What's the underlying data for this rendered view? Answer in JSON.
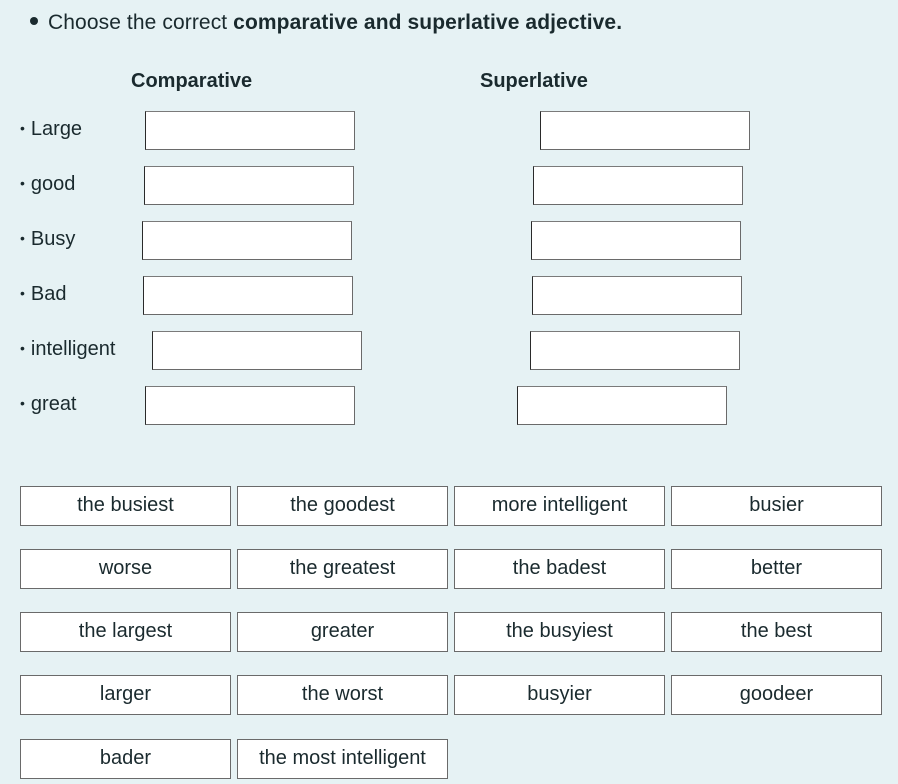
{
  "instruction": {
    "prefix": "Choose the correct ",
    "bold": "comparative and superlative adjective."
  },
  "columns": {
    "comparative": "Comparative",
    "superlative": "Superlative"
  },
  "adjectives": [
    {
      "label": "Large",
      "comparative_value": "",
      "superlative_value": ""
    },
    {
      "label": "good",
      "comparative_value": "",
      "superlative_value": ""
    },
    {
      "label": "Busy",
      "comparative_value": "",
      "superlative_value": ""
    },
    {
      "label": "Bad",
      "comparative_value": "",
      "superlative_value": ""
    },
    {
      "label": "intelligent",
      "comparative_value": "",
      "superlative_value": ""
    },
    {
      "label": "great",
      "comparative_value": "",
      "superlative_value": ""
    }
  ],
  "word_bank": [
    "the busiest",
    "the goodest",
    "more intelligent",
    "busier",
    "worse",
    "the greatest",
    "the badest",
    "better",
    "the largest",
    "greater",
    "the busyiest",
    "the best",
    "larger",
    "the worst",
    "busyier",
    "goodeer",
    "bader",
    "the most intelligent"
  ],
  "bullet": "•"
}
